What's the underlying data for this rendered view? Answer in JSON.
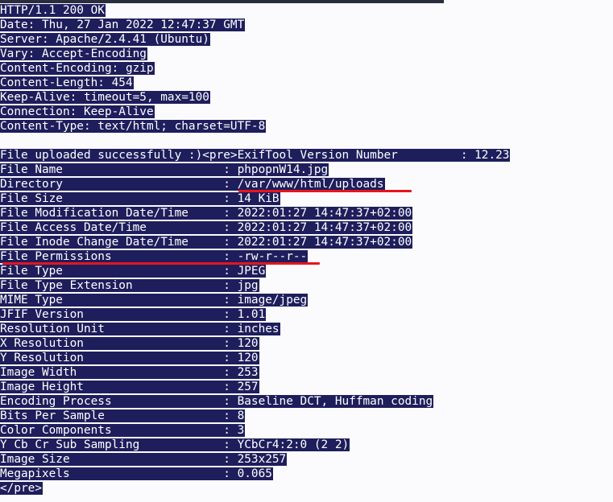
{
  "header": {
    "status": "HTTP/1.1 200 OK",
    "date": "Date: Thu, 27 Jan 2022 12:47:37 GMT",
    "server": "Server: Apache/2.4.41 (Ubuntu)",
    "vary": "Vary: Accept-Encoding",
    "content_encoding": "Content-Encoding: gzip",
    "content_length": "Content-Length: 454",
    "keep_alive": "Keep-Alive: timeout=5, max=100",
    "connection": "Connection: Keep-Alive",
    "content_type": "Content-Type: text/html; charset=UTF-8"
  },
  "body": {
    "first_line": "File uploaded successfully :)<pre>ExifTool Version Number         : 12.23",
    "rows": [
      "File Name                       : phpopnW14.jpg",
      "Directory                       : /var/www/html/uploads",
      "File Size                       : 14 KiB",
      "File Modification Date/Time     : 2022:01:27 14:47:37+02:00",
      "File Access Date/Time           : 2022:01:27 14:47:37+02:00",
      "File Inode Change Date/Time     : 2022:01:27 14:47:37+02:00",
      "File Permissions                : -rw-r--r--",
      "File Type                       : JPEG",
      "File Type Extension             : jpg",
      "MIME Type                       : image/jpeg",
      "JFIF Version                    : 1.01",
      "Resolution Unit                 : inches",
      "X Resolution                    : 120",
      "Y Resolution                    : 120",
      "Image Width                     : 253",
      "Image Height                    : 257",
      "Encoding Process                : Baseline DCT, Huffman coding",
      "Bits Per Sample                 : 8",
      "Color Components                : 3",
      "Y Cb Cr Sub Sampling            : YCbCr4:2:0 (2 2)",
      "Image Size                      : 253x257",
      "Megapixels                      : 0.065"
    ],
    "closing_tag": "</pre>"
  },
  "colors": {
    "text_highlight": "#1e1e5c",
    "annotation": "#e8141c",
    "background": "#fbfbfe"
  }
}
